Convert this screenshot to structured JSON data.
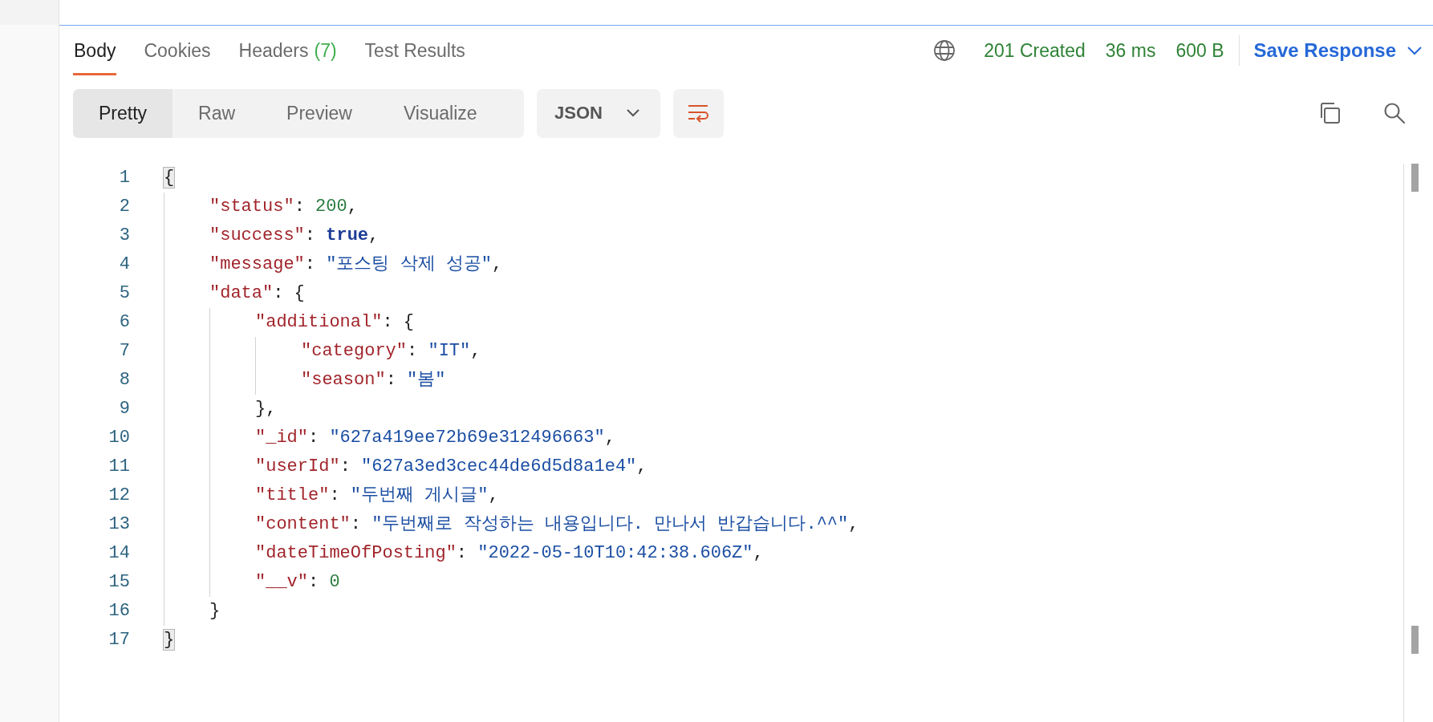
{
  "tabs": [
    {
      "label": "Body",
      "selected": true
    },
    {
      "label": "Cookies",
      "selected": false
    },
    {
      "label": "Headers",
      "count": "(7)",
      "selected": false
    },
    {
      "label": "Test Results",
      "selected": false
    }
  ],
  "status": {
    "code": "201 Created",
    "time": "36 ms",
    "size": "600 B"
  },
  "save_response": {
    "label": "Save Response"
  },
  "view_modes": [
    {
      "label": "Pretty",
      "selected": true
    },
    {
      "label": "Raw",
      "selected": false
    },
    {
      "label": "Preview",
      "selected": false
    },
    {
      "label": "Visualize",
      "selected": false
    }
  ],
  "format": {
    "value": "JSON"
  },
  "wrap": {
    "on": true
  },
  "code": {
    "lines": [
      {
        "number": "1",
        "matched": true,
        "tokens": [
          {
            "kind": "punct",
            "text": "{"
          }
        ],
        "children": [
          {
            "number": "2",
            "matched": false,
            "tokens": [
              {
                "kind": "key",
                "text": "\"status\""
              },
              {
                "kind": "punct",
                "text": ": "
              },
              {
                "kind": "number",
                "text": "200"
              },
              {
                "kind": "punct",
                "text": ","
              }
            ]
          },
          {
            "number": "3",
            "matched": false,
            "tokens": [
              {
                "kind": "key",
                "text": "\"success\""
              },
              {
                "kind": "punct",
                "text": ": "
              },
              {
                "kind": "boolean",
                "text": "true"
              },
              {
                "kind": "punct",
                "text": ","
              }
            ]
          },
          {
            "number": "4",
            "matched": false,
            "tokens": [
              {
                "kind": "key",
                "text": "\"message\""
              },
              {
                "kind": "punct",
                "text": ": "
              },
              {
                "kind": "string",
                "text": "\"포스팅 삭제 성공\""
              },
              {
                "kind": "punct",
                "text": ","
              }
            ]
          },
          {
            "number": "5",
            "matched": false,
            "tokens": [
              {
                "kind": "key",
                "text": "\"data\""
              },
              {
                "kind": "punct",
                "text": ": {"
              }
            ],
            "children": [
              {
                "number": "6",
                "matched": false,
                "tokens": [
                  {
                    "kind": "key",
                    "text": "\"additional\""
                  },
                  {
                    "kind": "punct",
                    "text": ": {"
                  }
                ],
                "children": [
                  {
                    "number": "7",
                    "matched": false,
                    "tokens": [
                      {
                        "kind": "key",
                        "text": "\"category\""
                      },
                      {
                        "kind": "punct",
                        "text": ": "
                      },
                      {
                        "kind": "string",
                        "text": "\"IT\""
                      },
                      {
                        "kind": "punct",
                        "text": ","
                      }
                    ]
                  },
                  {
                    "number": "8",
                    "matched": false,
                    "tokens": [
                      {
                        "kind": "key",
                        "text": "\"season\""
                      },
                      {
                        "kind": "punct",
                        "text": ": "
                      },
                      {
                        "kind": "string",
                        "text": "\"봄\""
                      }
                    ]
                  }
                ]
              },
              {
                "number": "9",
                "matched": false,
                "tokens": [
                  {
                    "kind": "punct",
                    "text": "},"
                  }
                ]
              },
              {
                "number": "10",
                "matched": false,
                "tokens": [
                  {
                    "kind": "key",
                    "text": "\"_id\""
                  },
                  {
                    "kind": "punct",
                    "text": ": "
                  },
                  {
                    "kind": "string",
                    "text": "\"627a419ee72b69e312496663\""
                  },
                  {
                    "kind": "punct",
                    "text": ","
                  }
                ]
              },
              {
                "number": "11",
                "matched": false,
                "tokens": [
                  {
                    "kind": "key",
                    "text": "\"userId\""
                  },
                  {
                    "kind": "punct",
                    "text": ": "
                  },
                  {
                    "kind": "string",
                    "text": "\"627a3ed3cec44de6d5d8a1e4\""
                  },
                  {
                    "kind": "punct",
                    "text": ","
                  }
                ]
              },
              {
                "number": "12",
                "matched": false,
                "tokens": [
                  {
                    "kind": "key",
                    "text": "\"title\""
                  },
                  {
                    "kind": "punct",
                    "text": ": "
                  },
                  {
                    "kind": "string",
                    "text": "\"두번째 게시글\""
                  },
                  {
                    "kind": "punct",
                    "text": ","
                  }
                ]
              },
              {
                "number": "13",
                "matched": false,
                "tokens": [
                  {
                    "kind": "key",
                    "text": "\"content\""
                  },
                  {
                    "kind": "punct",
                    "text": ": "
                  },
                  {
                    "kind": "string",
                    "text": "\"두번째로 작성하는 내용입니다. 만나서 반갑습니다.^^\""
                  },
                  {
                    "kind": "punct",
                    "text": ","
                  }
                ]
              },
              {
                "number": "14",
                "matched": false,
                "tokens": [
                  {
                    "kind": "key",
                    "text": "\"dateTimeOfPosting\""
                  },
                  {
                    "kind": "punct",
                    "text": ": "
                  },
                  {
                    "kind": "string",
                    "text": "\"2022-05-10T10:42:38.606Z\""
                  },
                  {
                    "kind": "punct",
                    "text": ","
                  }
                ]
              },
              {
                "number": "15",
                "matched": false,
                "tokens": [
                  {
                    "kind": "key",
                    "text": "\"__v\""
                  },
                  {
                    "kind": "punct",
                    "text": ": "
                  },
                  {
                    "kind": "number",
                    "text": "0"
                  }
                ]
              }
            ]
          },
          {
            "number": "16",
            "matched": false,
            "tokens": [
              {
                "kind": "punct",
                "text": "}"
              }
            ]
          }
        ]
      },
      {
        "number": "17",
        "matched": true,
        "tokens": [
          {
            "kind": "punct",
            "text": "}"
          }
        ]
      }
    ]
  }
}
